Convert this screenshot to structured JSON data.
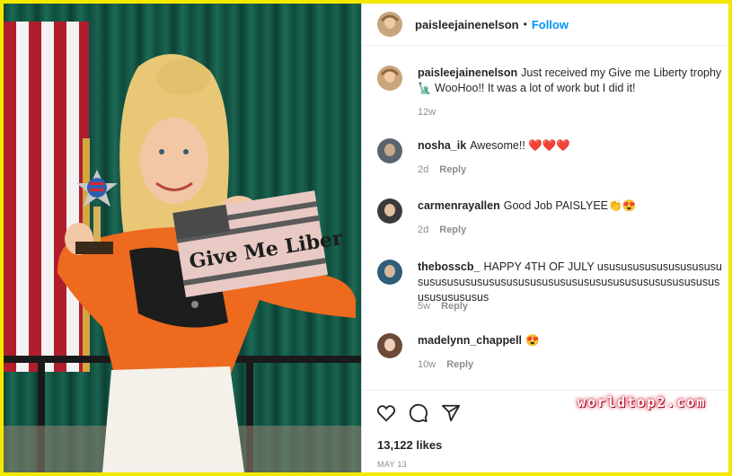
{
  "post": {
    "image_alt": "Girl holding a trophy and a Give me Liberty flag",
    "flag_text": "Give Me Liber",
    "author": "paisleejainenelson",
    "separator": "•",
    "follow_label": "Follow"
  },
  "caption": {
    "username": "paisleejainenelson",
    "text": "Just received my Give me Liberty trophy🗽 WooHoo!! It was a lot of work but I did it!",
    "time": "12w"
  },
  "comments": [
    {
      "username": "nosha_ik",
      "text": "Awesome!! ❤️❤️❤️",
      "time": "2d",
      "reply": "Reply"
    },
    {
      "username": "carmenrayallen",
      "text": "Good Job PAISLYEE👏😍",
      "time": "2d",
      "reply": "Reply"
    },
    {
      "username": "thebosscb_",
      "text": "HAPPY 4TH OF JULY usususususususususususususususususususususususususususususususususususususususususus",
      "time": "5w",
      "reply": "Reply"
    },
    {
      "username": "madelynn_chappell",
      "text": "😍",
      "time": "10w",
      "reply": "Reply"
    }
  ],
  "footer": {
    "likes": "13,122 likes",
    "date": "MAY 13"
  },
  "watermark": "worldtop2.com",
  "colors": {
    "accent": "#0095f6",
    "border": "#f5e800",
    "text": "#262626",
    "muted": "#8e8e8e"
  },
  "icons": [
    "heart-icon",
    "comment-icon",
    "share-icon"
  ]
}
